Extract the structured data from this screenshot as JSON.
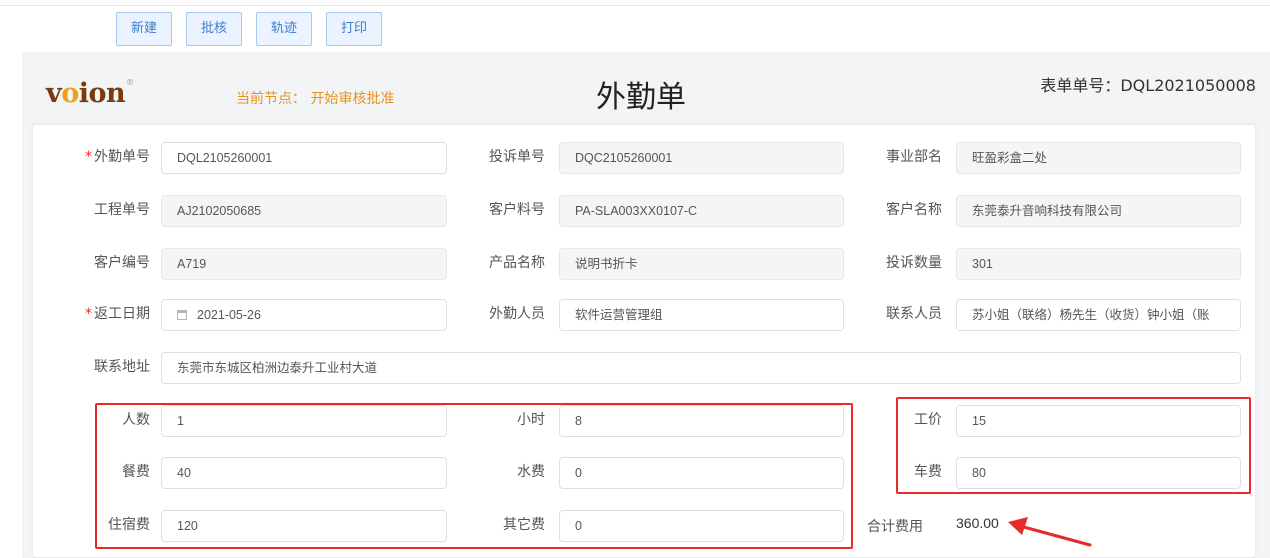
{
  "toolbar": {
    "new": "新建",
    "approve": "批核",
    "trace": "轨迹",
    "print": "打印"
  },
  "header": {
    "logo": "voion",
    "current_node": "当前节点： 开始审核批准",
    "title": "外勤单",
    "form_no": "表单单号：DQL2021050008"
  },
  "form": {
    "field_no_label": "外勤单号",
    "field_no": "DQL2105260001",
    "complaint_no_label": "投诉单号",
    "complaint_no": "DQC2105260001",
    "dept_label": "事业部名",
    "dept": "旺盈彩盒二处",
    "project_no_label": "工程单号",
    "project_no": "AJ2102050685",
    "material_no_label": "客户料号",
    "material_no": "PA-SLA003XX0107-C",
    "customer_name_label": "客户名称",
    "customer_name": "东莞泰升音响科技有限公司",
    "customer_code_label": "客户编号",
    "customer_code": "A719",
    "product_name_label": "产品名称",
    "product_name": "说明书折卡",
    "complaint_qty_label": "投诉数量",
    "complaint_qty": "301",
    "rework_date_label": "返工日期",
    "rework_date": "2021-05-26",
    "staff_label": "外勤人员",
    "staff": "软件运营管理组",
    "contact_label": "联系人员",
    "contact": "苏小姐（联络）杨先生（收货）钟小姐（账",
    "address_label": "联系地址",
    "address": "东莞市东城区柏洲边泰升工业村大道",
    "people_label": "人数",
    "people": "1",
    "hours_label": "小时",
    "hours": "8",
    "wage_label": "工价",
    "wage": "15",
    "meal_label": "餐费",
    "meal": "40",
    "water_label": "水费",
    "water": "0",
    "car_label": "车费",
    "car": "80",
    "lodging_label": "住宿费",
    "lodging": "120",
    "other_label": "其它费",
    "other": "0",
    "total_label": "合计费用",
    "total": "360.00"
  },
  "colors": {
    "accent": "#3a7fd0",
    "node": "#e8941a",
    "highlight": "#e82a2a",
    "required": "#f5222d"
  }
}
